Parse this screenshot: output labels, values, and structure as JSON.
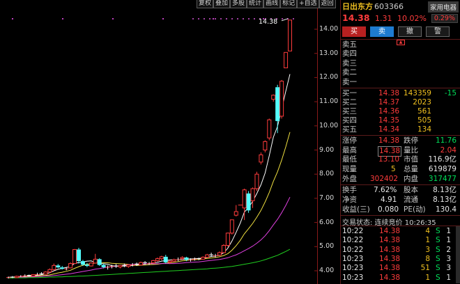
{
  "toolbar": [
    "复权",
    "叠加",
    "多股",
    "统计",
    "画线",
    "标记",
    "+自选",
    "返回"
  ],
  "y_axis": [
    {
      "label": "14.00",
      "v": 14.0
    },
    {
      "label": "13.00",
      "v": 13.0
    },
    {
      "label": "12.00",
      "v": 12.0
    },
    {
      "label": "11.00",
      "v": 11.0
    },
    {
      "label": "10.00",
      "v": 10.0
    },
    {
      "label": "9.00",
      "v": 9.0
    },
    {
      "label": "8.00",
      "v": 8.0
    },
    {
      "label": "7.00",
      "v": 7.0
    },
    {
      "label": "6.00",
      "v": 6.0
    },
    {
      "label": "5.00",
      "v": 5.0
    },
    {
      "label": "4.00",
      "v": 4.0
    }
  ],
  "chart_data": {
    "type": "candlestick",
    "max_label": "14.38",
    "candles": [
      {
        "o": 3.72,
        "h": 3.76,
        "l": 3.68,
        "c": 3.74
      },
      {
        "o": 3.74,
        "h": 3.78,
        "l": 3.7,
        "c": 3.72
      },
      {
        "o": 3.72,
        "h": 3.8,
        "l": 3.7,
        "c": 3.77
      },
      {
        "o": 3.77,
        "h": 3.82,
        "l": 3.74,
        "c": 3.79
      },
      {
        "o": 3.79,
        "h": 3.85,
        "l": 3.75,
        "c": 3.81
      },
      {
        "o": 3.81,
        "h": 3.84,
        "l": 3.76,
        "c": 3.78
      },
      {
        "o": 3.78,
        "h": 3.86,
        "l": 3.76,
        "c": 3.84
      },
      {
        "o": 3.84,
        "h": 3.92,
        "l": 3.8,
        "c": 3.88
      },
      {
        "o": 3.88,
        "h": 3.94,
        "l": 3.83,
        "c": 3.86
      },
      {
        "o": 3.86,
        "h": 3.98,
        "l": 3.84,
        "c": 3.95
      },
      {
        "o": 3.95,
        "h": 4.1,
        "l": 3.9,
        "c": 4.05
      },
      {
        "o": 4.05,
        "h": 4.3,
        "l": 4.0,
        "c": 4.22
      },
      {
        "o": 4.22,
        "h": 4.28,
        "l": 4.1,
        "c": 4.14
      },
      {
        "o": 4.14,
        "h": 4.2,
        "l": 4.05,
        "c": 4.08
      },
      {
        "o": 4.08,
        "h": 4.15,
        "l": 4.02,
        "c": 4.12
      },
      {
        "o": 4.12,
        "h": 4.35,
        "l": 4.1,
        "c": 4.3
      },
      {
        "o": 4.3,
        "h": 4.9,
        "l": 4.28,
        "c": 4.88
      },
      {
        "o": 4.88,
        "h": 4.95,
        "l": 4.3,
        "c": 4.4
      },
      {
        "o": 4.4,
        "h": 4.45,
        "l": 4.2,
        "c": 4.25
      },
      {
        "o": 4.25,
        "h": 4.32,
        "l": 4.15,
        "c": 4.2
      },
      {
        "o": 4.2,
        "h": 4.35,
        "l": 4.18,
        "c": 4.32
      },
      {
        "o": 4.32,
        "h": 4.7,
        "l": 4.3,
        "c": 4.48
      },
      {
        "o": 4.48,
        "h": 4.52,
        "l": 4.2,
        "c": 4.24
      },
      {
        "o": 4.24,
        "h": 4.3,
        "l": 4.1,
        "c": 4.15
      },
      {
        "o": 4.15,
        "h": 4.22,
        "l": 4.05,
        "c": 4.18
      },
      {
        "o": 4.18,
        "h": 4.25,
        "l": 4.1,
        "c": 4.2
      },
      {
        "o": 4.2,
        "h": 4.28,
        "l": 4.12,
        "c": 4.16
      },
      {
        "o": 4.16,
        "h": 4.24,
        "l": 4.1,
        "c": 4.22
      },
      {
        "o": 4.22,
        "h": 4.3,
        "l": 4.15,
        "c": 4.18
      },
      {
        "o": 4.18,
        "h": 4.26,
        "l": 4.12,
        "c": 4.24
      },
      {
        "o": 4.24,
        "h": 4.32,
        "l": 4.18,
        "c": 4.28
      },
      {
        "o": 4.28,
        "h": 4.34,
        "l": 4.2,
        "c": 4.24
      },
      {
        "o": 4.24,
        "h": 4.38,
        "l": 4.22,
        "c": 4.34
      },
      {
        "o": 4.34,
        "h": 4.4,
        "l": 4.25,
        "c": 4.3
      },
      {
        "o": 4.3,
        "h": 4.36,
        "l": 4.24,
        "c": 4.33
      },
      {
        "o": 4.33,
        "h": 4.45,
        "l": 4.3,
        "c": 4.42
      },
      {
        "o": 4.42,
        "h": 4.55,
        "l": 4.38,
        "c": 4.5
      },
      {
        "o": 4.5,
        "h": 4.62,
        "l": 4.44,
        "c": 4.58
      },
      {
        "o": 4.58,
        "h": 4.66,
        "l": 4.3,
        "c": 4.35
      },
      {
        "o": 4.35,
        "h": 4.45,
        "l": 4.28,
        "c": 4.4
      },
      {
        "o": 4.4,
        "h": 4.5,
        "l": 4.35,
        "c": 4.46
      },
      {
        "o": 4.46,
        "h": 4.55,
        "l": 4.4,
        "c": 4.5
      },
      {
        "o": 4.5,
        "h": 4.6,
        "l": 4.45,
        "c": 4.55
      },
      {
        "o": 4.55,
        "h": 4.58,
        "l": 4.4,
        "c": 4.45
      },
      {
        "o": 4.45,
        "h": 4.52,
        "l": 4.38,
        "c": 4.48
      },
      {
        "o": 4.48,
        "h": 4.55,
        "l": 4.42,
        "c": 4.5
      },
      {
        "o": 4.5,
        "h": 4.54,
        "l": 4.44,
        "c": 4.48
      },
      {
        "o": 4.48,
        "h": 4.6,
        "l": 4.46,
        "c": 4.56
      },
      {
        "o": 4.56,
        "h": 4.7,
        "l": 4.52,
        "c": 4.66
      },
      {
        "o": 4.66,
        "h": 4.75,
        "l": 4.58,
        "c": 4.62
      },
      {
        "o": 4.62,
        "h": 4.7,
        "l": 4.55,
        "c": 4.65
      },
      {
        "o": 4.65,
        "h": 4.8,
        "l": 4.6,
        "c": 4.75
      },
      {
        "o": 4.75,
        "h": 5.1,
        "l": 4.72,
        "c": 5.05
      },
      {
        "o": 5.05,
        "h": 5.58,
        "l": 5.0,
        "c": 5.56
      },
      {
        "o": 5.56,
        "h": 6.12,
        "l": 5.5,
        "c": 6.11
      },
      {
        "o": 6.3,
        "h": 6.72,
        "l": 6.25,
        "c": 6.45
      },
      {
        "o": 6.72,
        "h": 6.72,
        "l": 6.72,
        "c": 6.72
      },
      {
        "o": 6.6,
        "h": 7.4,
        "l": 6.1,
        "c": 7.35
      },
      {
        "o": 7.2,
        "h": 7.3,
        "l": 6.4,
        "c": 6.5
      },
      {
        "o": 6.9,
        "h": 7.45,
        "l": 6.6,
        "c": 7.4
      },
      {
        "o": 7.4,
        "h": 8.1,
        "l": 7.3,
        "c": 8.0
      },
      {
        "o": 8.5,
        "h": 8.9,
        "l": 8.4,
        "c": 8.8
      },
      {
        "o": 9.0,
        "h": 9.4,
        "l": 8.9,
        "c": 9.35
      },
      {
        "o": 9.5,
        "h": 10.3,
        "l": 9.4,
        "c": 10.25
      },
      {
        "o": 11.1,
        "h": 11.3,
        "l": 11.0,
        "c": 11.27
      },
      {
        "o": 11.6,
        "h": 11.7,
        "l": 9.7,
        "c": 10.2
      },
      {
        "o": 10.4,
        "h": 11.9,
        "l": 10.3,
        "c": 11.85
      },
      {
        "o": 12.4,
        "h": 13.05,
        "l": 12.4,
        "c": 13.04
      },
      {
        "o": 13.1,
        "h": 14.38,
        "l": 13.1,
        "c": 14.38
      }
    ],
    "ma": [
      {
        "name": "MA5",
        "color": "#ffffff",
        "values": [
          3.73,
          3.74,
          3.75,
          3.76,
          3.78,
          3.79,
          3.8,
          3.82,
          3.84,
          3.87,
          3.92,
          4.0,
          4.06,
          4.1,
          4.14,
          4.17,
          4.31,
          4.34,
          4.36,
          4.4,
          4.41,
          4.34,
          4.3,
          4.29,
          4.27,
          4.21,
          4.19,
          4.19,
          4.2,
          4.2,
          4.22,
          4.24,
          4.25,
          4.28,
          4.3,
          4.33,
          4.35,
          4.4,
          4.42,
          4.45,
          4.46,
          4.46,
          4.47,
          4.49,
          4.49,
          4.5,
          4.51,
          4.52,
          4.56,
          4.59,
          4.61,
          4.65,
          4.74,
          4.94,
          5.23,
          5.59,
          5.97,
          6.43,
          6.62,
          6.87,
          7.2,
          7.56,
          8.05,
          8.76,
          9.53,
          9.98,
          10.7,
          11.44,
          12.14
        ]
      },
      {
        "name": "MA10",
        "color": "#f0e040",
        "values": [
          3.73,
          3.73,
          3.74,
          3.75,
          3.76,
          3.77,
          3.78,
          3.79,
          3.8,
          3.81,
          3.83,
          3.87,
          3.91,
          3.94,
          3.98,
          4.02,
          4.1,
          4.17,
          4.23,
          4.27,
          4.29,
          4.32,
          4.32,
          4.33,
          4.33,
          4.31,
          4.3,
          4.29,
          4.28,
          4.26,
          4.23,
          4.22,
          4.23,
          4.24,
          4.25,
          4.26,
          4.27,
          4.3,
          4.31,
          4.33,
          4.35,
          4.38,
          4.41,
          4.43,
          4.45,
          4.46,
          4.47,
          4.49,
          4.51,
          4.53,
          4.55,
          4.58,
          4.63,
          4.71,
          4.85,
          5.04,
          5.26,
          5.53,
          5.74,
          5.96,
          6.22,
          6.5,
          6.85,
          7.24,
          7.7,
          8.1,
          8.58,
          9.14,
          9.74
        ]
      },
      {
        "name": "MA20",
        "color": "#e040e0",
        "values": [
          3.73,
          3.73,
          3.73,
          3.74,
          3.74,
          3.75,
          3.75,
          3.76,
          3.77,
          3.78,
          3.79,
          3.8,
          3.82,
          3.84,
          3.86,
          3.88,
          3.91,
          3.94,
          3.97,
          4.0,
          4.03,
          4.07,
          4.09,
          4.12,
          4.15,
          4.17,
          4.19,
          4.21,
          4.23,
          4.25,
          4.26,
          4.27,
          4.28,
          4.29,
          4.29,
          4.29,
          4.29,
          4.3,
          4.3,
          4.3,
          4.3,
          4.31,
          4.32,
          4.34,
          4.35,
          4.36,
          4.37,
          4.39,
          4.41,
          4.43,
          4.45,
          4.47,
          4.5,
          4.54,
          4.6,
          4.66,
          4.74,
          4.83,
          4.92,
          5.02,
          5.14,
          5.28,
          5.45,
          5.66,
          5.9,
          6.13,
          6.4,
          6.71,
          7.05
        ]
      },
      {
        "name": "MA60",
        "color": "#20d020",
        "values": [
          3.7,
          3.7,
          3.71,
          3.71,
          3.71,
          3.72,
          3.72,
          3.72,
          3.73,
          3.73,
          3.74,
          3.74,
          3.75,
          3.75,
          3.76,
          3.76,
          3.77,
          3.78,
          3.78,
          3.79,
          3.8,
          3.81,
          3.82,
          3.83,
          3.84,
          3.85,
          3.86,
          3.87,
          3.88,
          3.89,
          3.9,
          3.91,
          3.92,
          3.93,
          3.94,
          3.95,
          3.96,
          3.97,
          3.98,
          3.99,
          4.0,
          4.01,
          4.02,
          4.03,
          4.04,
          4.05,
          4.06,
          4.07,
          4.08,
          4.1,
          4.11,
          4.12,
          4.14,
          4.16,
          4.18,
          4.21,
          4.24,
          4.27,
          4.3,
          4.33,
          4.37,
          4.41,
          4.46,
          4.52,
          4.58,
          4.64,
          4.72,
          4.8,
          4.89
        ]
      }
    ]
  },
  "stock": {
    "name": "日出东方",
    "code": "603366",
    "price": "14.38",
    "change": "1.31",
    "pct": "10.02%",
    "industry": "家用电器",
    "industry_pct": "0.29%"
  },
  "trade_buttons": [
    "买",
    "卖",
    "撤",
    "警"
  ],
  "asks": [
    "卖五",
    "卖四",
    "卖三",
    "卖二",
    "卖一"
  ],
  "bids": [
    {
      "label": "买一",
      "price": "14.38",
      "vol": "143359",
      "chg": "-15"
    },
    {
      "label": "买二",
      "price": "14.37",
      "vol": "2023",
      "chg": ""
    },
    {
      "label": "买三",
      "price": "14.36",
      "vol": "561",
      "chg": ""
    },
    {
      "label": "买四",
      "price": "14.35",
      "vol": "505",
      "chg": ""
    },
    {
      "label": "买五",
      "price": "14.34",
      "vol": "134",
      "chg": ""
    }
  ],
  "stats": {
    "limit_up_label": "涨停",
    "limit_up": "14.38",
    "limit_down_label": "跌停",
    "limit_down": "11.76",
    "high_label": "最高",
    "high": "14.38",
    "ratio_label": "量比",
    "ratio": "2.04",
    "low_label": "最低",
    "low": "13.10",
    "mktcap_label": "市值",
    "mktcap": "116.9亿",
    "cur_vol_label": "现量",
    "cur_vol": "5",
    "total_vol_label": "总量",
    "total_vol": "619879",
    "outer_label": "外盘",
    "outer": "302402",
    "inner_label": "内盘",
    "inner": "317477",
    "turnover_label": "换手",
    "turnover": "7.62%",
    "equity_label": "股本",
    "equity": "8.13亿",
    "net_assets_label": "净资",
    "net_assets": "4.91",
    "float_label": "流通",
    "float": "8.13亿",
    "eps_label": "收益(三)",
    "eps": "0.080",
    "pe_label": "PE(动)",
    "pe": "130.4"
  },
  "trade_status": "交易状态: 连续竞价 10:26:35",
  "ticks": [
    {
      "time": "10:22",
      "price": "14.38",
      "vol": "4",
      "side": "S",
      "n": "1"
    },
    {
      "time": "10:22",
      "price": "14.38",
      "vol": "1",
      "side": "S",
      "n": "1"
    },
    {
      "time": "10:22",
      "price": "14.38",
      "vol": "3",
      "side": "S",
      "n": "2"
    },
    {
      "time": "10:23",
      "price": "14.38",
      "vol": "8",
      "side": "S",
      "n": "3"
    },
    {
      "time": "10:23",
      "price": "14.38",
      "vol": "51",
      "side": "S",
      "n": "3"
    },
    {
      "time": "10:23",
      "price": "14.38",
      "vol": "1",
      "side": "S",
      "n": "1"
    }
  ]
}
